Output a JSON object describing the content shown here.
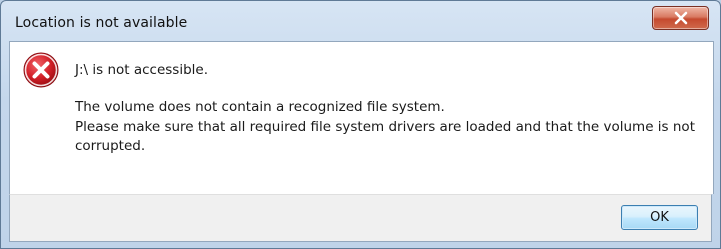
{
  "window": {
    "title": "Location is not available",
    "close_icon": "close-icon"
  },
  "content": {
    "icon": "error-icon",
    "headline": "J:\\ is not accessible.",
    "line1": "The volume does not contain a recognized file system.",
    "line2": "Please make sure that all required file system drivers are loaded and that the volume is not",
    "line3": "corrupted."
  },
  "footer": {
    "ok_label": "OK"
  },
  "colors": {
    "close_button": "#c54a2f",
    "error_icon": "#c8161d",
    "ok_border": "#3c7fb1"
  }
}
